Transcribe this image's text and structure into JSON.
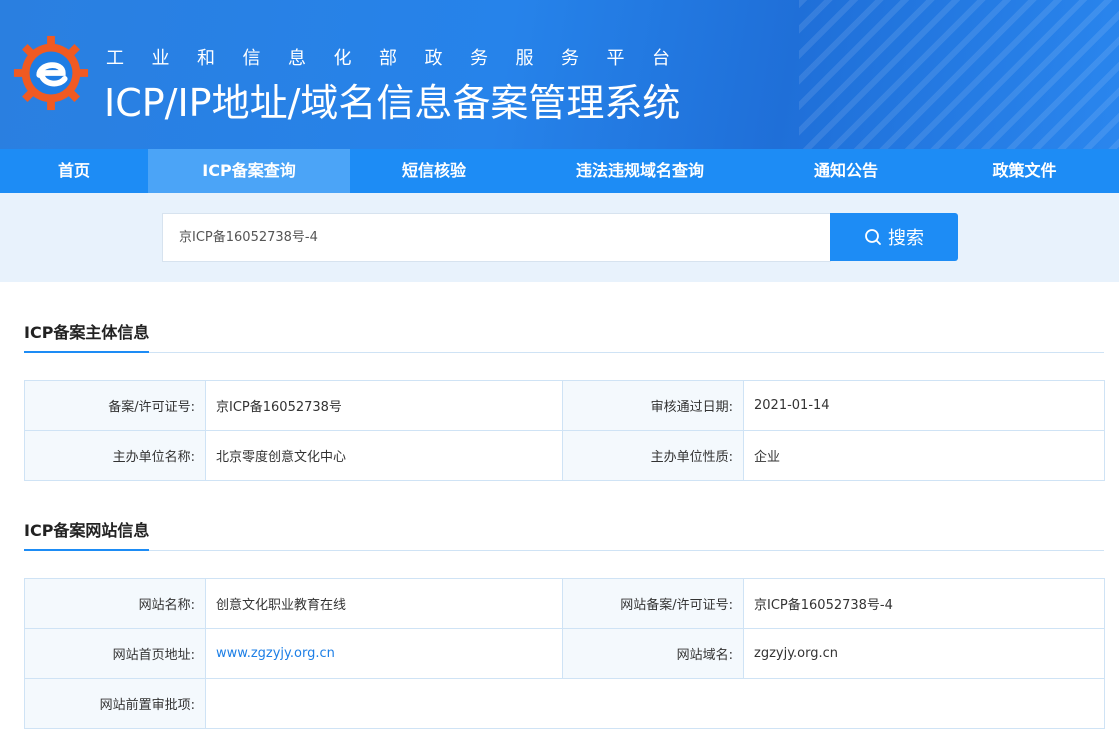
{
  "header": {
    "subtitle": "工业和信息化部政务服务平台",
    "title": "ICP/IP地址/域名信息备案管理系统"
  },
  "nav": {
    "items": [
      {
        "label": "首页",
        "active": false
      },
      {
        "label": "ICP备案查询",
        "active": true
      },
      {
        "label": "短信核验",
        "active": false
      },
      {
        "label": "违法违规域名查询",
        "active": false
      },
      {
        "label": "通知公告",
        "active": false
      },
      {
        "label": "政策文件",
        "active": false
      }
    ]
  },
  "search": {
    "value": "京ICP备16052738号-4",
    "button_label": "搜索"
  },
  "entity": {
    "section_title": "ICP备案主体信息",
    "license_label": "备案/许可证号:",
    "license_value": "京ICP备16052738号",
    "approve_date_label": "审核通过日期:",
    "approve_date_value": "2021-01-14",
    "org_name_label": "主办单位名称:",
    "org_name_value": "北京零度创意文化中心",
    "org_type_label": "主办单位性质:",
    "org_type_value": "企业"
  },
  "website": {
    "section_title": "ICP备案网站信息",
    "name_label": "网站名称:",
    "name_value": "创意文化职业教育在线",
    "license_label": "网站备案/许可证号:",
    "license_value": "京ICP备16052738号-4",
    "homepage_label": "网站首页地址:",
    "homepage_value": "www.zgzyjy.org.cn",
    "domain_label": "网站域名:",
    "domain_value": "zgzyjy.org.cn",
    "preapproval_label": "网站前置审批项:",
    "preapproval_value": ""
  },
  "colors": {
    "primary": "#1d8cf5",
    "nav_active": "#4ba4f7",
    "logo_orange": "#f05a22"
  }
}
